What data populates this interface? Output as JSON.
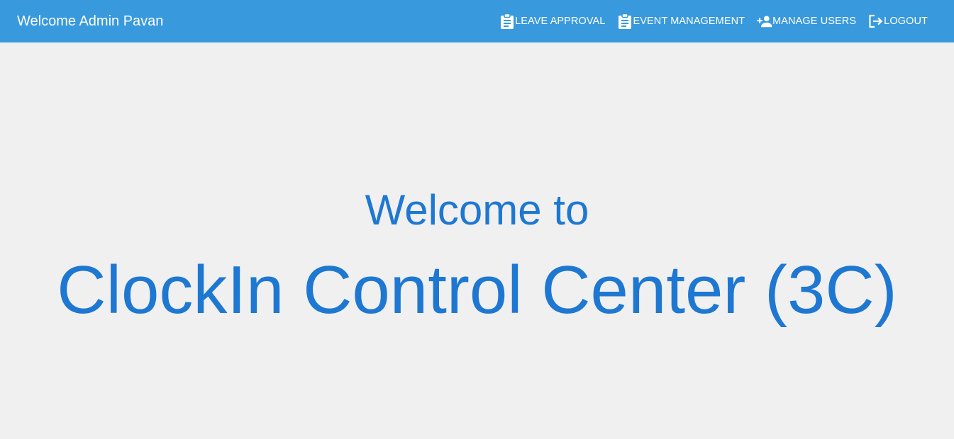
{
  "header": {
    "title": "Welcome Admin Pavan",
    "background_color": "#3899dc",
    "nav": [
      {
        "label": "LEAVE APPROVAL",
        "icon": "clipboard-icon"
      },
      {
        "label": "EVENT MANAGEMENT",
        "icon": "clipboard-icon"
      },
      {
        "label": "MANAGE USERS",
        "icon": "person-add-icon"
      },
      {
        "label": "LOGOUT",
        "icon": "logout-icon"
      }
    ]
  },
  "hero": {
    "line1": "Welcome to",
    "line2": "ClockIn Control Center (3C)",
    "text_color": "#1e78d2"
  },
  "page": {
    "background_color": "#f0f0f0"
  }
}
